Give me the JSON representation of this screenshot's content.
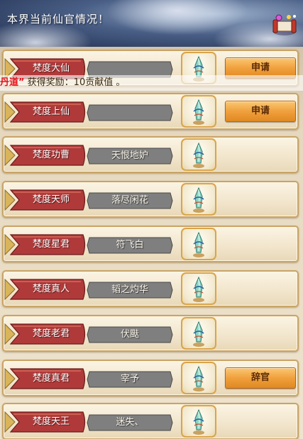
{
  "header": {
    "title": "本界当前仙官情况！"
  },
  "notice": {
    "highlight": "丹道”",
    "text": " 获得奖励：10贡献值 。"
  },
  "ranks": [
    {
      "title": "梵度大仙",
      "name": "",
      "action": "申请"
    },
    {
      "title": "梵度上仙",
      "name": "",
      "action": "申请"
    },
    {
      "title": "梵度功曹",
      "name": "天恨地妒",
      "action": ""
    },
    {
      "title": "梵度天师",
      "name": "落尽闲花",
      "action": ""
    },
    {
      "title": "梵度星君",
      "name": "符飞白",
      "action": ""
    },
    {
      "title": "梵度真人",
      "name": "韬之灼华",
      "action": ""
    },
    {
      "title": "梵度老君",
      "name": "伏颫",
      "action": ""
    },
    {
      "title": "梵度真君",
      "name": "宰予",
      "action": "辞官"
    },
    {
      "title": "梵度天王",
      "name": "迷失、",
      "action": ""
    }
  ],
  "colors": {
    "banner_red": "#b03a3a",
    "button_orange": "#f0a03d",
    "notice_red": "#e8101a",
    "row_border": "#c9a467"
  },
  "icons": {
    "item": "crystal-jade-icon",
    "header": "scroll-icon"
  }
}
